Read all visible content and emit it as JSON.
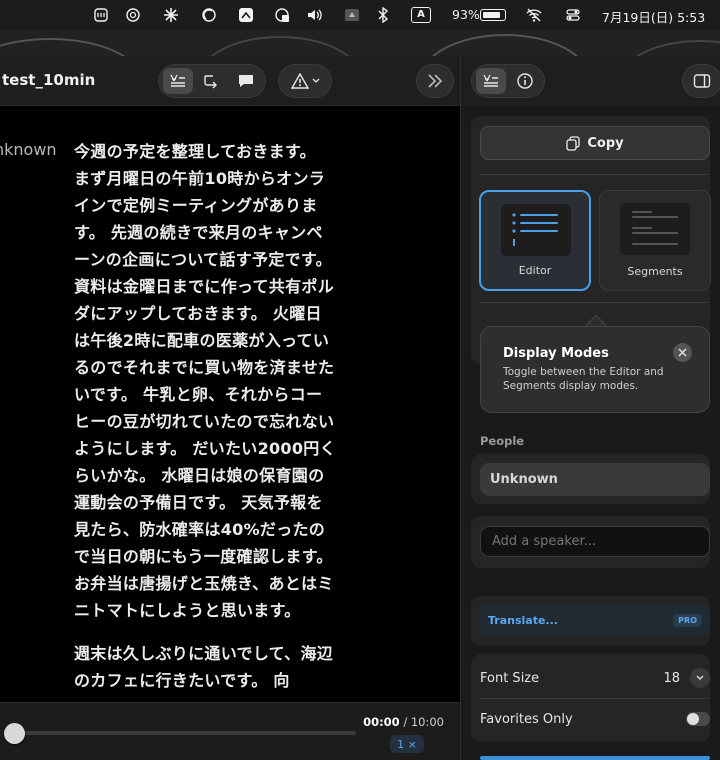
{
  "menubar": {
    "battery_percent": "93%",
    "input_indicator": "A",
    "clock": "7月19日(日)  5:53"
  },
  "document": {
    "title": "test_10min",
    "speaker": "nknown",
    "paragraphs": [
      "今週の予定を整理しておきます。 まず月曜日の午前10時からオンラインで定例ミーティングがあります。 先週の続きで来月のキャンペーンの企画について話す予定です。 資料は金曜日までに作って共有ポルダにアップしておきます。 火曜日は午後2時に配車の医薬が入っているのでそれまでに買い物を済ませたいです。 牛乳と卵、それからコーヒーの豆が切れていたので忘れないようにします。 だいたい2000円くらいかな。 水曜日は娘の保育園の運動会の予備日です。 天気予報を見たら、防水確率は40%だったので当日の朝にもう一度確認します。 お弁当は唐揚げと玉焼き、あとはミニトマトにしようと思います。",
      "週末は久しぶりに通いでして、海辺のカフェに行きたいです。 向"
    ]
  },
  "player": {
    "current_time": "00:00",
    "total_time": " / 10:00",
    "speed": "1 ×",
    "progress_fraction": 0.0
  },
  "inspector": {
    "copy_label": "Copy",
    "modes": [
      {
        "label": "Editor",
        "selected": true
      },
      {
        "label": "Segments",
        "selected": false
      }
    ],
    "popover": {
      "title": "Display Modes",
      "description": "Toggle between the Editor and Segments display modes."
    },
    "people_label": "People",
    "people_value": "Unknown",
    "speaker_placeholder": "Add a speaker...",
    "translate_label": "Translate...",
    "pro_badge": "PRO",
    "font_size_label": "Font Size",
    "font_size_value": "18",
    "favorites_label": "Favorites Only",
    "favorites_on": false
  },
  "colors": {
    "accent": "#4a9fe8",
    "link": "#5aa8f0"
  }
}
